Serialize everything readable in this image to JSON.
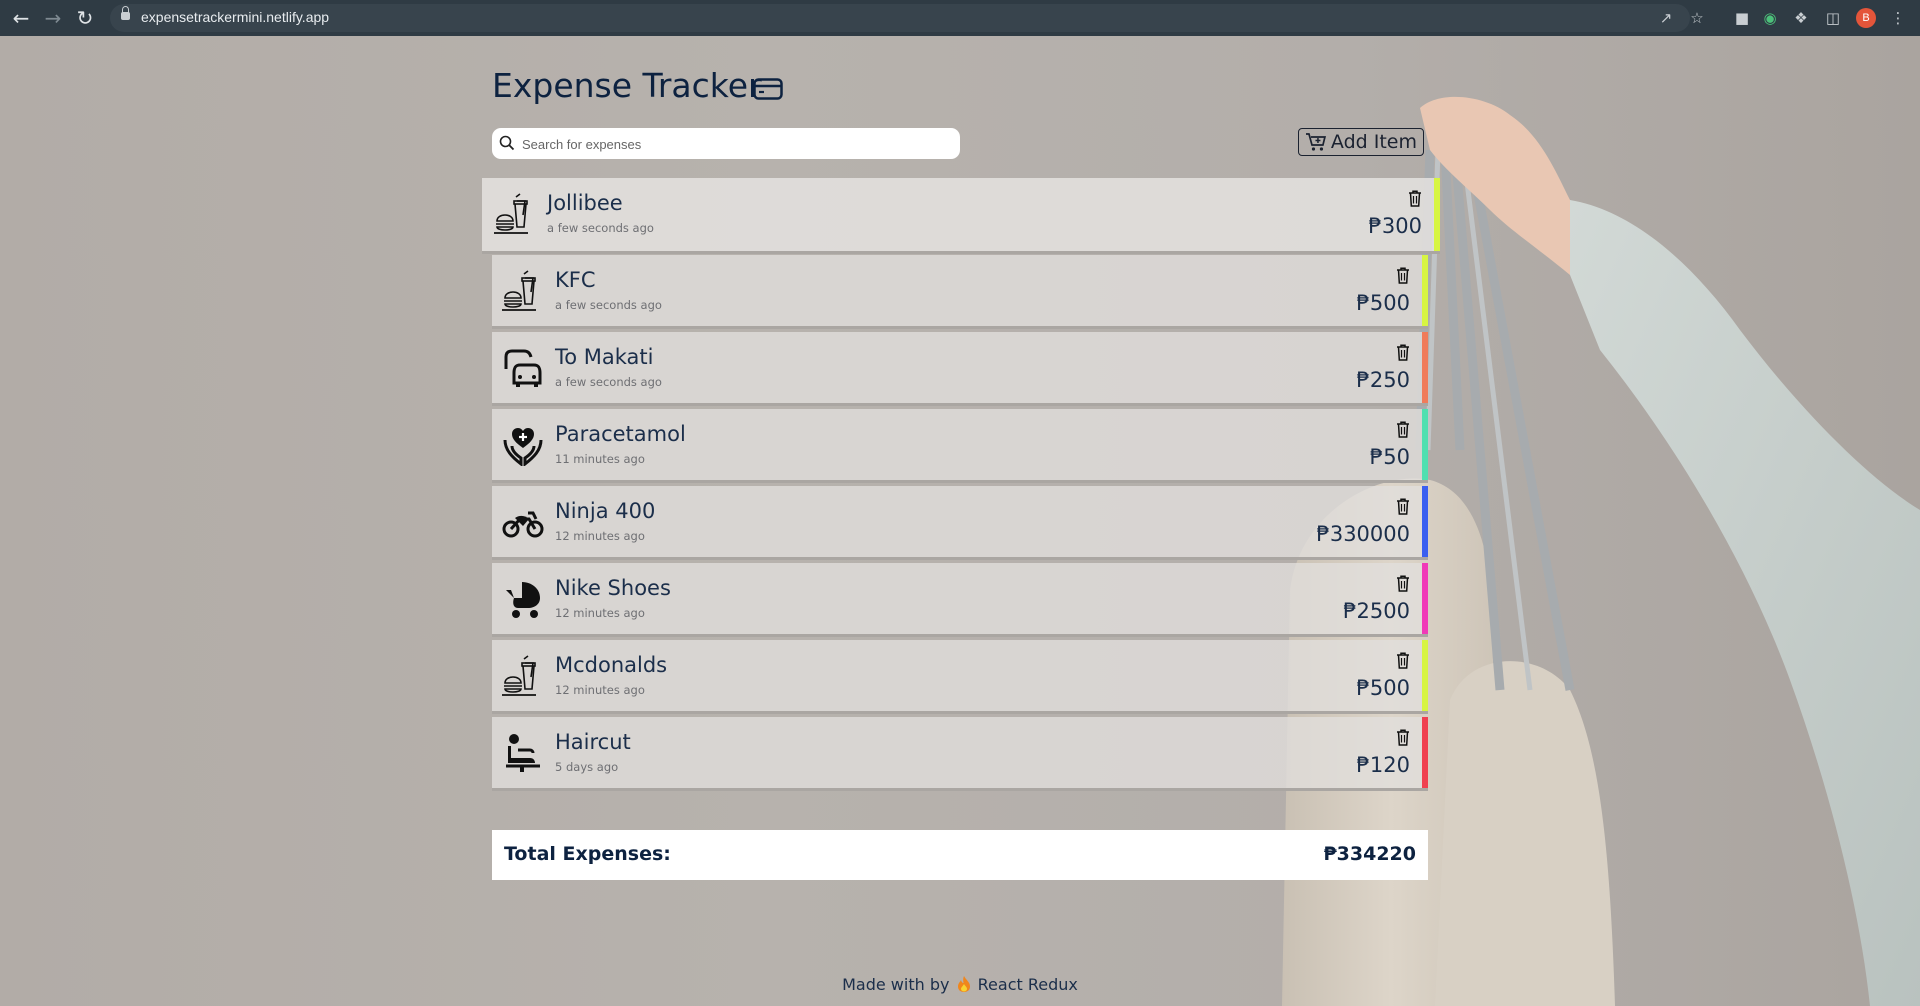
{
  "browser": {
    "url": "expensetrackermini.netlify.app",
    "profile_initial": "B"
  },
  "app": {
    "title": "Expense Tracker",
    "search_placeholder": "Search for expenses",
    "add_button_label": "Add Item"
  },
  "expenses": [
    {
      "name": "Jollibee",
      "time": "a few seconds ago",
      "amount": "₱300",
      "icon": "fast-food-icon",
      "color": "#d7f542"
    },
    {
      "name": "KFC",
      "time": "a few seconds ago",
      "amount": "₱500",
      "icon": "fast-food-icon",
      "color": "#d7f542"
    },
    {
      "name": "To Makati",
      "time": "a few seconds ago",
      "amount": "₱250",
      "icon": "car-icon",
      "color": "#f07b5a"
    },
    {
      "name": "Paracetamol",
      "time": "11 minutes ago",
      "amount": "₱50",
      "icon": "health-care-icon",
      "color": "#4fe0b0"
    },
    {
      "name": "Ninja 400",
      "time": "12 minutes ago",
      "amount": "₱330000",
      "icon": "motorcycle-icon",
      "color": "#3a5ff0"
    },
    {
      "name": "Nike Shoes",
      "time": "12 minutes ago",
      "amount": "₱2500",
      "icon": "stroller-icon",
      "color": "#f03ab8"
    },
    {
      "name": "Mcdonalds",
      "time": "12 minutes ago",
      "amount": "₱500",
      "icon": "fast-food-icon",
      "color": "#d7f542"
    },
    {
      "name": "Haircut",
      "time": "5 days ago",
      "amount": "₱120",
      "icon": "barber-chair-icon",
      "color": "#f04050"
    }
  ],
  "total": {
    "label": "Total Expenses:",
    "value": "₱334220"
  },
  "footer": {
    "prefix": "Made with by",
    "suffix": "React Redux"
  }
}
